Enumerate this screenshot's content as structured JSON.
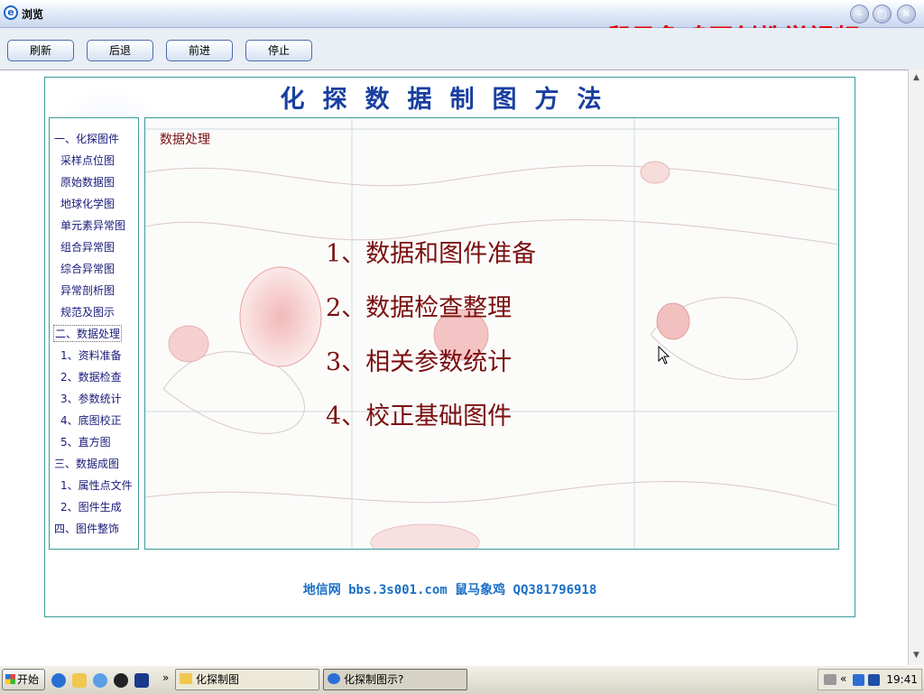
{
  "window": {
    "title": "浏览",
    "watermark": "鼠马象鸡原创教学视频",
    "controls": {
      "minimize": "–",
      "restore": "▢",
      "close": "✕"
    }
  },
  "toolbar": {
    "refresh": "刷新",
    "back": "后退",
    "forward": "前进",
    "stop": "停止"
  },
  "page": {
    "title": "化探数据制图方法",
    "nav": [
      "一、化探图件",
      "采样点位图",
      "原始数据图",
      "地球化学图",
      "单元素异常图",
      "组合异常图",
      "综合异常图",
      "异常剖析图",
      "规范及图示",
      "二、数据处理",
      "1、资料准备",
      "2、数据检查",
      "3、参数统计",
      "4、底图校正",
      "5、直方图",
      "三、数据成图",
      "1、属性点文件",
      "2、图件生成",
      "四、图件整饰"
    ],
    "active_nav": "二、数据处理",
    "section_heading": "数据处理",
    "list": [
      "1、数据和图件准备",
      "2、数据检查整理",
      "3、相关参数统计",
      "4、校正基础图件"
    ],
    "footer": "地信网 bbs.3s001.com 鼠马象鸡 QQ381796918"
  },
  "taskbar": {
    "start": "开始",
    "overflow": "»",
    "tasks": [
      "化探制图",
      "化探制图示?"
    ],
    "tray_overflow": "«",
    "clock": "19:41"
  },
  "colors": {
    "title": "#1a3fa0",
    "watermark": "#e00000",
    "list": "#7a1010",
    "footer": "#1a6fc6",
    "frame": "#3a9a9a"
  }
}
